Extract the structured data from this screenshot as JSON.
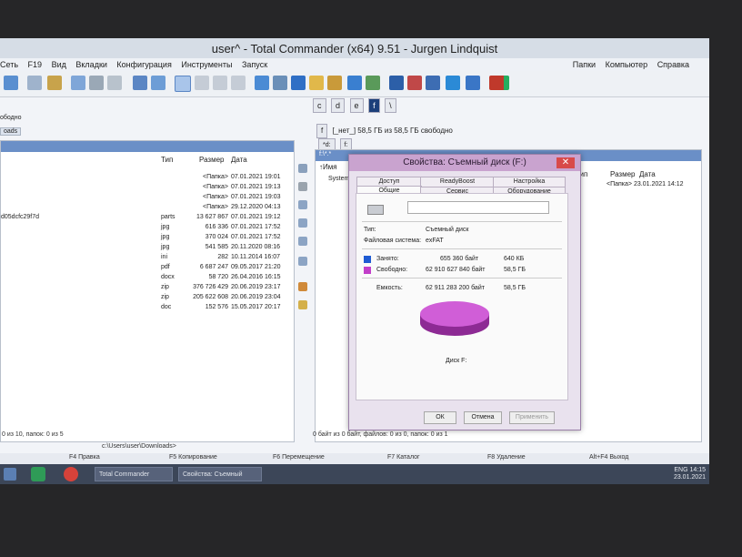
{
  "window": {
    "title": "user^ - Total Commander (x64) 9.51 - Jurgen Lindquist"
  },
  "menu": {
    "items": [
      "Сеть",
      "F19",
      "Вид",
      "Вкладки",
      "Конфигурация",
      "Инструменты",
      "Запуск"
    ],
    "right_items": [
      "Папки",
      "Компьютер",
      "Справка"
    ]
  },
  "drives": {
    "left_list": [
      "c",
      "d",
      "e",
      "f",
      "\\"
    ],
    "left_path": "ободно",
    "left_tab": "oads",
    "right_drive": "f",
    "right_status": "[_нет_]  58,5 ГБ из 58,5 ГБ свободно",
    "right_tab1": "*d:",
    "right_tab2": "f:",
    "right_path": "f:\\*.*",
    "right_col_name": "↑Имя",
    "right_folder": "System"
  },
  "left_panel": {
    "columns": [
      "Тип",
      "Размер",
      "Дата"
    ],
    "rows": [
      {
        "name": "",
        "type": "",
        "size": "<Папка>",
        "date": "07.01.2021 19:01"
      },
      {
        "name": "",
        "type": "",
        "size": "<Папка>",
        "date": "07.01.2021 19:13"
      },
      {
        "name": "",
        "type": "",
        "size": "<Папка>",
        "date": "07.01.2021 19:03"
      },
      {
        "name": "",
        "type": "",
        "size": "<Папка>",
        "date": "29.12.2020 04:13"
      },
      {
        "name": "d05dcfc29f7d",
        "type": "parts",
        "size": "13 627 867",
        "date": "07.01.2021 19:12"
      },
      {
        "name": "",
        "type": "jpg",
        "size": "616 336",
        "date": "07.01.2021 17:52"
      },
      {
        "name": "",
        "type": "jpg",
        "size": "370 024",
        "date": "07.01.2021 17:52"
      },
      {
        "name": "",
        "type": "jpg",
        "size": "541 585",
        "date": "20.11.2020 08:16"
      },
      {
        "name": "",
        "type": "ini",
        "size": "282",
        "date": "10.11.2014 16:07"
      },
      {
        "name": "",
        "type": "pdf",
        "size": "6 687 247",
        "date": "09.05.2017 21:20"
      },
      {
        "name": "",
        "type": "docx",
        "size": "58 720",
        "date": "26.04.2016 16:15"
      },
      {
        "name": "",
        "type": "zip",
        "size": "376 726 429",
        "date": "20.06.2019 23:17"
      },
      {
        "name": "",
        "type": "zip",
        "size": "205 622 608",
        "date": "20.06.2019 23:04"
      },
      {
        "name": "",
        "type": "doc",
        "size": "152 576",
        "date": "15.05.2017 20:17"
      }
    ],
    "status": "0 из 10, папок: 0 из 5",
    "cmd_path": "c:\\Users\\user\\Downloads>"
  },
  "right_panel": {
    "columns": [
      "Тип",
      "Размер",
      "Дата"
    ],
    "row": {
      "size": "<Папка>",
      "date": "23.01.2021 14:12"
    },
    "status": "0 байт из 0 байт, файлов: 0 из 0, папок: 0 из 1"
  },
  "fkeys": [
    "F4 Правка",
    "F5 Копирование",
    "F6 Перемещение",
    "F7 Каталог",
    "F8 Удаление",
    "Alt+F4 Выход"
  ],
  "taskbar": {
    "items": [
      "Total Commander",
      "Свойства: Съемный"
    ],
    "lang": "ENG",
    "time": "14:15",
    "date": "23.01.2021"
  },
  "dialog": {
    "title": "Свойства: Съемный диск (F:)",
    "close": "✕",
    "tabs_top": [
      "Доступ",
      "ReadyBoost",
      "Настройка"
    ],
    "tabs_bottom": [
      "Общие",
      "Сервис",
      "Оборудование"
    ],
    "type_label": "Тип:",
    "type_value": "Съемный диск",
    "fs_label": "Файловая система:",
    "fs_value": "exFAT",
    "used_label": "Занято:",
    "used_bytes": "655 360 байт",
    "used_short": "640 КБ",
    "free_label": "Свободно:",
    "free_bytes": "62 910 627 840 байт",
    "free_short": "58,5 ГБ",
    "cap_label": "Емкость:",
    "cap_bytes": "62 911 283 200 байт",
    "cap_short": "58,5 ГБ",
    "disk_label": "Диск F:",
    "ok": "ОК",
    "cancel": "Отмена",
    "apply": "Применить",
    "colors": {
      "used": "#1f5bd3",
      "free": "#c23fc9",
      "pie_top": "#d05ed7",
      "pie_side": "#8d2a94"
    },
    "used_fraction": 1e-05
  }
}
